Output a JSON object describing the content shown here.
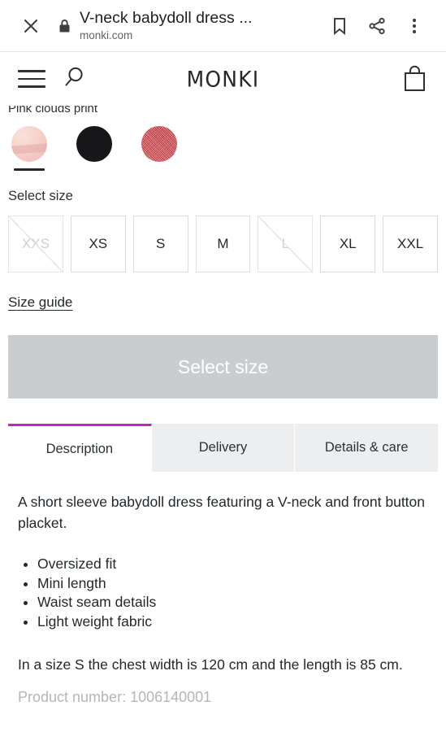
{
  "browser": {
    "close_icon": "close-icon",
    "lock_icon": "lock-icon",
    "title": "V-neck babydoll dress ...",
    "host": "monki.com",
    "bookmark_icon": "bookmark-icon",
    "share_icon": "share-icon",
    "menu_icon": "overflow-menu-icon"
  },
  "site_header": {
    "menu_icon": "hamburger-menu-icon",
    "search_icon": "search-icon",
    "logo": "MONKI",
    "bag_icon": "shopping-bag-icon"
  },
  "product": {
    "color_name": "Pink clouds print",
    "colors": [
      {
        "name": "pink-clouds-print",
        "hex": "#f3cbc4",
        "selected": true
      },
      {
        "name": "black",
        "hex": "#17171a",
        "selected": false
      },
      {
        "name": "red",
        "hex": "#e8474f",
        "selected": false
      }
    ],
    "select_size_label": "Select size",
    "sizes": [
      {
        "label": "XXS",
        "available": false
      },
      {
        "label": "XS",
        "available": true
      },
      {
        "label": "S",
        "available": true
      },
      {
        "label": "M",
        "available": true
      },
      {
        "label": "L",
        "available": false
      },
      {
        "label": "XL",
        "available": true
      },
      {
        "label": "XXL",
        "available": true
      }
    ],
    "size_guide_label": "Size guide",
    "cta_label": "Select size",
    "cta_color": "#c9cdd0"
  },
  "tabs": {
    "active_accent": "#c026c0",
    "items": [
      {
        "label": "Description",
        "active": true
      },
      {
        "label": "Delivery",
        "active": false
      },
      {
        "label": "Details & care",
        "active": false
      }
    ]
  },
  "description": {
    "intro": "A short sleeve babydoll dress featuring a V-neck and front button placket.",
    "features": [
      "Oversized fit",
      "Mini length",
      "Waist seam details",
      "Light weight fabric"
    ],
    "measurements": "In a size S the chest width is 120 cm and the length is 85 cm.",
    "product_number": "Product number: 1006140001"
  }
}
